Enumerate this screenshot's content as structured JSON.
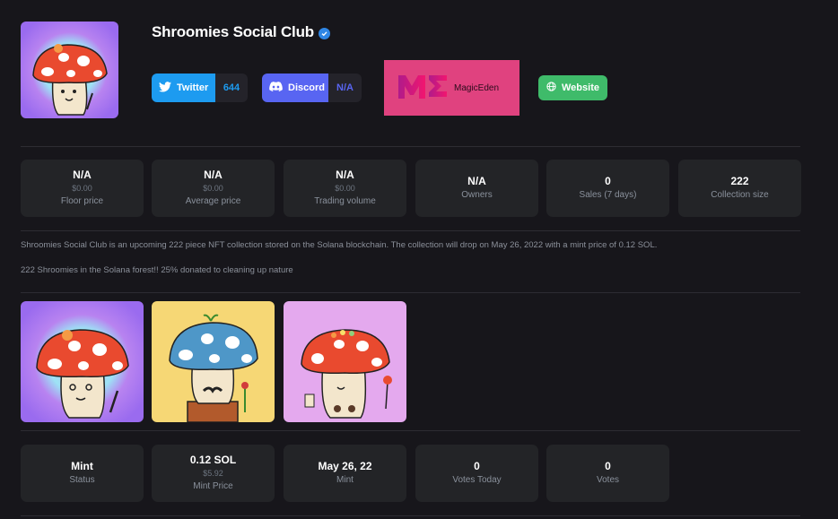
{
  "header": {
    "title": "Shroomies Social Club",
    "avatar_alt": "Shroomies avatar"
  },
  "socials": {
    "twitter": {
      "label": "Twitter",
      "count": "644"
    },
    "discord": {
      "label": "Discord",
      "count": "N/A"
    },
    "magiceden": {
      "label": "MagicEden"
    },
    "website": {
      "label": "Website"
    }
  },
  "stats": [
    {
      "value": "N/A",
      "sub": "$0.00",
      "label": "Floor price"
    },
    {
      "value": "N/A",
      "sub": "$0.00",
      "label": "Average price"
    },
    {
      "value": "N/A",
      "sub": "$0.00",
      "label": "Trading volume"
    },
    {
      "value": "N/A",
      "label": "Owners"
    },
    {
      "value": "0",
      "label": "Sales (7 days)"
    },
    {
      "value": "222",
      "label": "Collection size"
    }
  ],
  "description": {
    "line1": "Shroomies Social Club is an upcoming 222 piece NFT collection stored on the Solana blockchain. The collection will drop on May 26, 2022 with a mint price of 0.12 SOL.",
    "line2": "222 Shroomies in the Solana forest!! 25% donated to cleaning up nature"
  },
  "mint_stats": [
    {
      "value": "Mint",
      "label": "Status"
    },
    {
      "value": "0.12 SOL",
      "sub": "$5.92",
      "label": "Mint Price"
    },
    {
      "value": "May 26, 22",
      "label": "Mint"
    },
    {
      "value": "0",
      "label": "Votes Today"
    },
    {
      "value": "0",
      "label": "Votes"
    }
  ],
  "colors": {
    "background": "#17161b",
    "card": "#232427",
    "twitter": "#1d9bf0",
    "discord": "#5865f2",
    "magiceden": "#e0427f",
    "website": "#3fbb6a",
    "verified": "#2f86e5"
  }
}
